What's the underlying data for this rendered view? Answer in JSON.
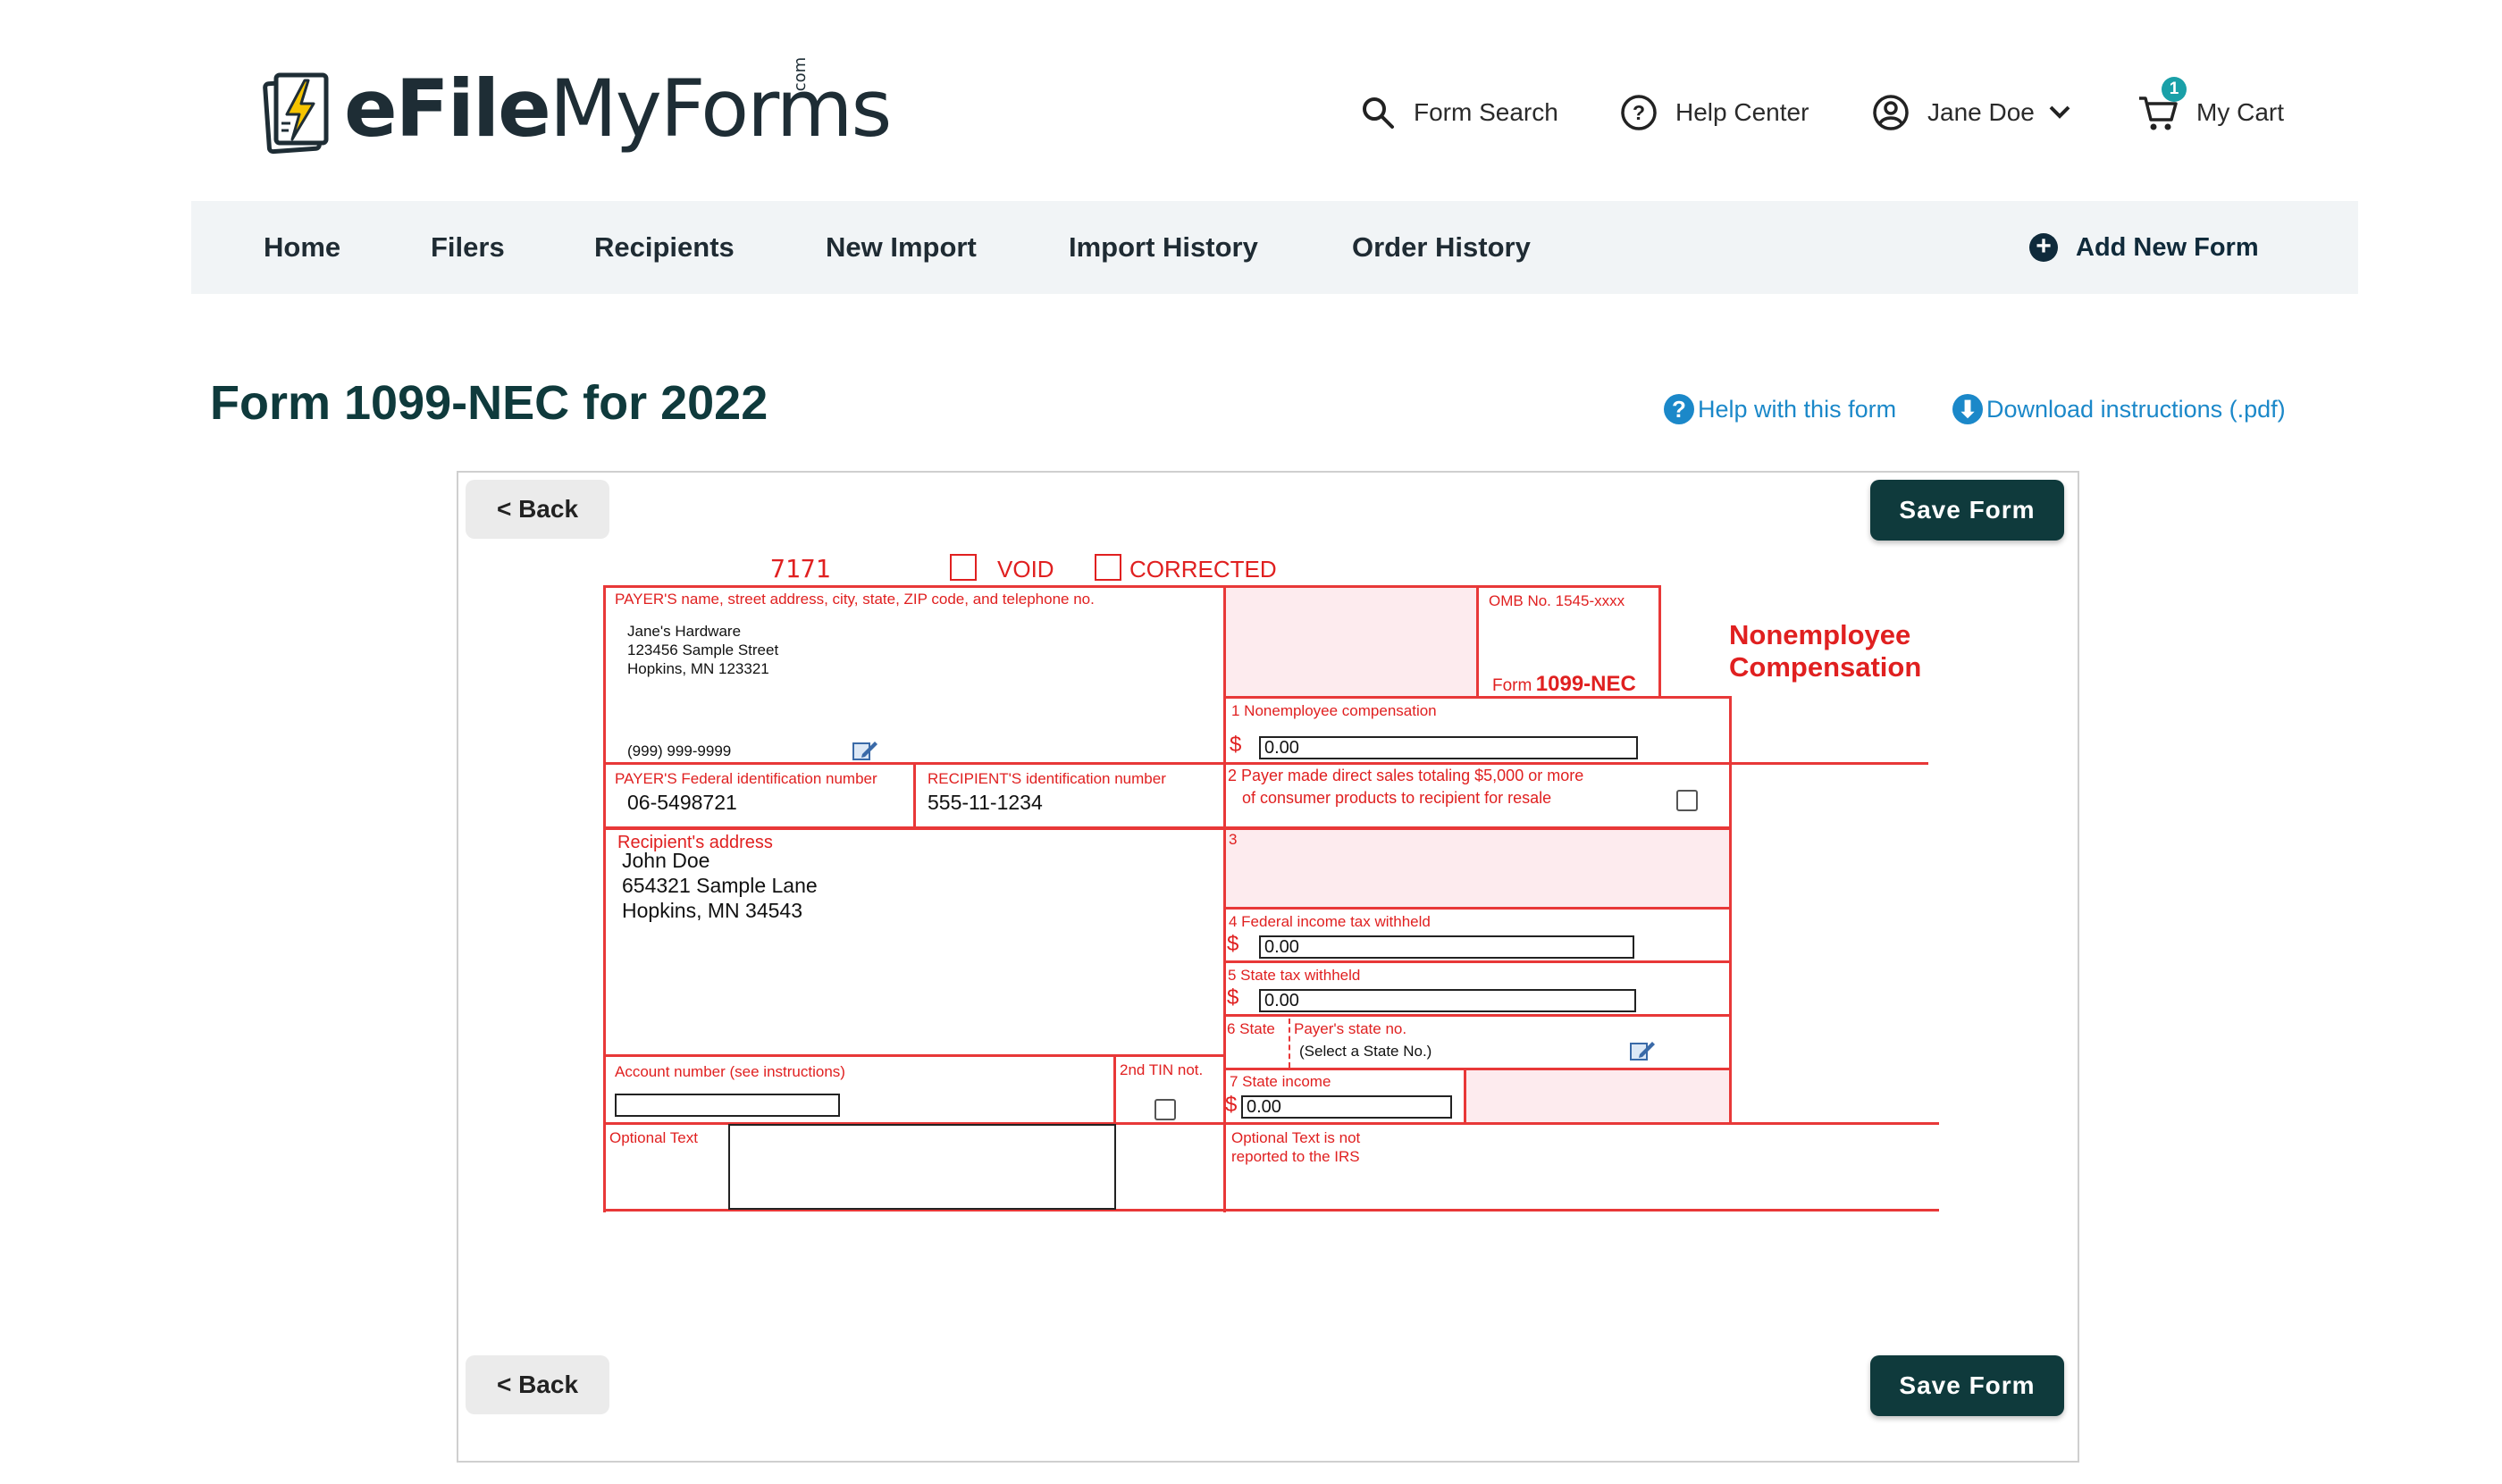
{
  "header": {
    "logo_bold": "eFile",
    "logo_light": "MyForms",
    "logo_suffix": ".com",
    "form_search": "Form Search",
    "help_center": "Help Center",
    "user_name": "Jane Doe",
    "cart_label": "My Cart",
    "cart_count": "1"
  },
  "nav": {
    "items": [
      "Home",
      "Filers",
      "Recipients",
      "New Import",
      "Import History",
      "Order History"
    ],
    "add_new_form": "Add New Form"
  },
  "page": {
    "title": "Form 1099-NEC for 2022",
    "help_link": "Help with this form",
    "download_link": "Download instructions (.pdf)",
    "back_label": "< Back",
    "save_label": "Save Form"
  },
  "form": {
    "form_code": "7171",
    "void_label": "VOID",
    "corrected_label": "CORRECTED",
    "payer_label": "PAYER'S name, street address, city, state, ZIP code, and telephone no.",
    "payer_name": "Jane's Hardware",
    "payer_street": "123456 Sample Street",
    "payer_city": "Hopkins, MN 123321",
    "payer_phone": "(999) 999-9999",
    "omb_label": "OMB No. 1545-xxxx",
    "form_word": "Form",
    "form_number": "1099-NEC",
    "side_title_1": "Nonemployee",
    "side_title_2": "Compensation",
    "box1_label": "1  Nonemployee compensation",
    "box1_value": "0.00",
    "payer_tin_label": "PAYER'S Federal identification number",
    "payer_tin": "06-5498721",
    "recipient_tin_label": "RECIPIENT'S identification number",
    "recipient_tin": "555-11-1234",
    "box2_label_1": "2 Payer made direct sales totaling $5,000 or more",
    "box2_label_2": "of consumer products to recipient for resale",
    "recipient_address_label": "Recipient's address",
    "recipient_name": "John Doe",
    "recipient_street": "654321 Sample Lane",
    "recipient_city": "Hopkins, MN 34543",
    "box3_label": "3",
    "box4_label": "4  Federal income tax withheld",
    "box4_value": "0.00",
    "box5_label": "5 State tax withheld",
    "box5_value": "0.00",
    "box6_label": "6 State",
    "payer_state_no_label": "Payer's state no.",
    "payer_state_no_value": "(Select a State No.)",
    "box7_label": "7  State income",
    "box7_value": "0.00",
    "account_label": "Account number (see instructions)",
    "tin_not_label": "2nd TIN not.",
    "optional_text_label": "Optional Text",
    "optional_note_1": "Optional Text is not",
    "optional_note_2": "reported to the IRS",
    "dollar": "$"
  },
  "colors": {
    "brand_dark": "#0f3a3c",
    "link_blue": "#1b88c9",
    "form_red": "#e02020",
    "nav_bg": "#f1f4f6"
  }
}
